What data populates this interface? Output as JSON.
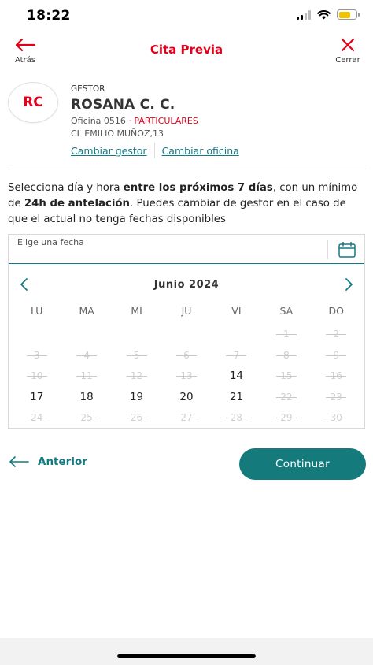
{
  "status_bar": {
    "time": "18:22"
  },
  "nav": {
    "back_label": "Atrás",
    "title": "Cita Previa",
    "close_label": "Cerrar"
  },
  "colors": {
    "brand_red": "#e2001a",
    "teal": "#117a82",
    "button_teal": "#147a7c"
  },
  "gestor": {
    "initials": "RC",
    "label": "GESTOR",
    "name": "ROSANA C. C.",
    "office_prefix": "Oficina 0516 · ",
    "segment": "PARTICULARES",
    "address": "CL EMILIO MUÑOZ,13",
    "change_gestor": "Cambiar gestor",
    "change_office": "Cambiar oficina"
  },
  "instructions": {
    "part1": "Selecciona día y hora ",
    "bold1": "entre los próximos 7 días",
    "part2": ", con un mínimo de ",
    "bold2": "24h de antelación",
    "part3": ". Puedes cambiar de gestor en el caso de que el actual no tenga fechas disponibles"
  },
  "calendar": {
    "date_placeholder": "Elige una fecha",
    "month_label": "Junio  2024",
    "weekdays": [
      "LU",
      "MA",
      "MI",
      "JU",
      "VI",
      "SÁ",
      "DO"
    ],
    "leading_blanks": 5,
    "days": [
      {
        "d": "1",
        "enabled": false
      },
      {
        "d": "2",
        "enabled": false
      },
      {
        "d": "3",
        "enabled": false
      },
      {
        "d": "4",
        "enabled": false
      },
      {
        "d": "5",
        "enabled": false
      },
      {
        "d": "6",
        "enabled": false
      },
      {
        "d": "7",
        "enabled": false
      },
      {
        "d": "8",
        "enabled": false
      },
      {
        "d": "9",
        "enabled": false
      },
      {
        "d": "10",
        "enabled": false
      },
      {
        "d": "11",
        "enabled": false
      },
      {
        "d": "12",
        "enabled": false
      },
      {
        "d": "13",
        "enabled": false
      },
      {
        "d": "14",
        "enabled": true
      },
      {
        "d": "15",
        "enabled": false
      },
      {
        "d": "16",
        "enabled": false
      },
      {
        "d": "17",
        "enabled": true
      },
      {
        "d": "18",
        "enabled": true
      },
      {
        "d": "19",
        "enabled": true
      },
      {
        "d": "20",
        "enabled": true
      },
      {
        "d": "21",
        "enabled": true
      },
      {
        "d": "22",
        "enabled": false
      },
      {
        "d": "23",
        "enabled": false
      },
      {
        "d": "24",
        "enabled": false
      },
      {
        "d": "25",
        "enabled": false
      },
      {
        "d": "26",
        "enabled": false
      },
      {
        "d": "27",
        "enabled": false
      },
      {
        "d": "28",
        "enabled": false
      },
      {
        "d": "29",
        "enabled": false
      },
      {
        "d": "30",
        "enabled": false
      }
    ]
  },
  "actions": {
    "previous": "Anterior",
    "continue": "Continuar"
  }
}
